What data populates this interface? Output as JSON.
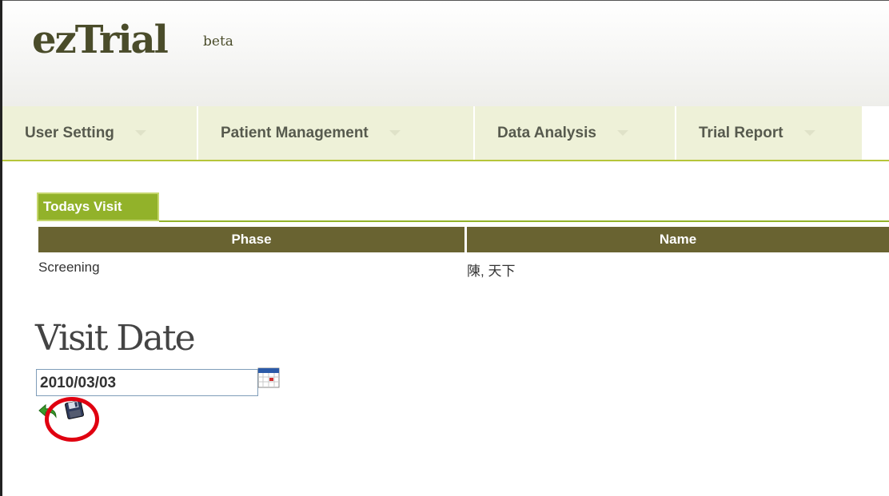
{
  "app": {
    "logo_text": "ezTrial",
    "logo_badge": "beta"
  },
  "nav": {
    "items": [
      {
        "label": "User Setting",
        "icon": "chevron-down-icon"
      },
      {
        "label": "Patient Management",
        "icon": "chevron-down-icon"
      },
      {
        "label": "Data Analysis",
        "icon": "chevron-down-icon"
      },
      {
        "label": "Trial Report",
        "icon": "chevron-down-icon"
      }
    ]
  },
  "todays_visit": {
    "tab_label": "Todays Visit",
    "columns": [
      "Phase",
      "Name"
    ],
    "rows": [
      {
        "phase": "Screening",
        "name": "陳, 天下"
      }
    ]
  },
  "visit_date": {
    "heading": "Visit Date",
    "value": "2010/03/03",
    "calendar_icon": "calendar-icon",
    "undo_icon": "undo-icon",
    "save_icon": "floppy-disk-save-icon"
  },
  "colors": {
    "accent_green": "#92b22a",
    "table_header": "#696331",
    "nav_bg": "#eef1d8",
    "highlight": "#e00010"
  }
}
